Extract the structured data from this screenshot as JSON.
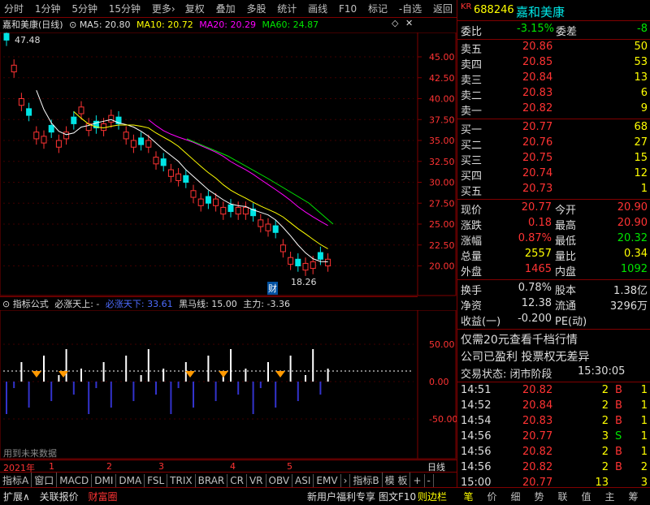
{
  "toolbar": {
    "items": [
      "分时",
      "1分钟",
      "5分钟",
      "15分钟",
      "更多›"
    ],
    "right": [
      "复权",
      "叠加",
      "多股",
      "统计",
      "画线",
      "F10",
      "标记",
      "-自选",
      "返回"
    ]
  },
  "chart": {
    "title": "嘉和美康(日线)",
    "ma5": "MA5: 20.80",
    "ma10": "MA10: 20.72",
    "ma20": "MA20: 20.29",
    "ma60": "MA60: 24.87",
    "high_label": "47.48",
    "low_label": "18.26",
    "cai": "财",
    "y_ticks": [
      "45.00",
      "42.50",
      "40.00",
      "37.50",
      "35.00",
      "32.50",
      "30.00",
      "27.50",
      "25.00",
      "22.50",
      "20.00"
    ]
  },
  "indicator": {
    "name": "指标公式",
    "label1": "必涨天上: -",
    "label2": "必涨天下: 33.61",
    "label3": "黑马线: 15.00",
    "label4": "主力: -3.36",
    "y_ticks": [
      "50.00",
      "0.00",
      "-50.00"
    ],
    "future": "用到未来数据"
  },
  "timeline": {
    "year": "2021年",
    "months": [
      "1",
      "2",
      "3",
      "4",
      "5"
    ],
    "period": "日线"
  },
  "tabs": [
    "指标A",
    "窗口",
    "MACD",
    "DMI",
    "DMA",
    "FSL",
    "TRIX",
    "BRAR",
    "CR",
    "VR",
    "OBV",
    "ASI",
    "EMV",
    "›",
    "指标B",
    "模 板",
    "+",
    "-"
  ],
  "bottom": {
    "left": [
      "扩展∧",
      "关联报价",
      "财富圈"
    ],
    "center": "新用户福利专享",
    "right_labels": [
      "图文F10",
      "则边栏"
    ],
    "right_tabs": [
      "笔",
      "价",
      "细",
      "势",
      "联",
      "值",
      "主",
      "筹"
    ]
  },
  "quote": {
    "market": "KR",
    "code": "688246",
    "name": "嘉和美康",
    "weibi": {
      "label": "委比",
      "value": "-3.15%",
      "label2": "委差",
      "value2": "-8"
    },
    "sells": [
      {
        "l": "卖五",
        "p": "20.86",
        "v": "50"
      },
      {
        "l": "卖四",
        "p": "20.85",
        "v": "53"
      },
      {
        "l": "卖三",
        "p": "20.84",
        "v": "13"
      },
      {
        "l": "卖二",
        "p": "20.83",
        "v": "6"
      },
      {
        "l": "卖一",
        "p": "20.82",
        "v": "9"
      }
    ],
    "buys": [
      {
        "l": "买一",
        "p": "20.77",
        "v": "68"
      },
      {
        "l": "买二",
        "p": "20.76",
        "v": "27"
      },
      {
        "l": "买三",
        "p": "20.75",
        "v": "15"
      },
      {
        "l": "买四",
        "p": "20.74",
        "v": "12"
      },
      {
        "l": "买五",
        "p": "20.73",
        "v": "1"
      }
    ],
    "stats": [
      {
        "l1": "现价",
        "v1": "20.77",
        "l2": "今开",
        "v2": "20.90"
      },
      {
        "l1": "涨跌",
        "v1": "0.18",
        "l2": "最高",
        "v2": "20.90"
      },
      {
        "l1": "涨幅",
        "v1": "0.87%",
        "l2": "最低",
        "v2": "20.32"
      },
      {
        "l1": "总量",
        "v1": "2557",
        "l2": "量比",
        "v2": "0.34"
      },
      {
        "l1": "外盘",
        "v1": "1465",
        "l2": "内盘",
        "v2": "1092"
      }
    ],
    "stats2": [
      {
        "l1": "换手",
        "v1": "0.78%",
        "l2": "股本",
        "v2": "1.38亿"
      },
      {
        "l1": "净资",
        "v1": "12.38",
        "l2": "流通",
        "v2": "3296万"
      },
      {
        "l1": "收益(一)",
        "v1": "-0.200",
        "l2": "PE(动)",
        "v2": ""
      }
    ],
    "ad1": "仅需20元查看千档行情",
    "ad2": "公司已盈利 投票权无差异",
    "status_label": "交易状态: 闭市阶段",
    "status_time": "15:30:05",
    "ticks": [
      {
        "t": "14:51",
        "p": "20.82",
        "v": "2",
        "d": "B",
        "n": "1"
      },
      {
        "t": "14:52",
        "p": "20.84",
        "v": "2",
        "d": "B",
        "n": "1"
      },
      {
        "t": "14:54",
        "p": "20.83",
        "v": "2",
        "d": "B",
        "n": "1"
      },
      {
        "t": "14:56",
        "p": "20.77",
        "v": "3",
        "d": "S",
        "n": "1"
      },
      {
        "t": "14:56",
        "p": "20.82",
        "v": "2",
        "d": "B",
        "n": "1"
      },
      {
        "t": "14:56",
        "p": "20.82",
        "v": "2",
        "d": "B",
        "n": "2"
      },
      {
        "t": "15:00",
        "p": "20.77",
        "v": "13",
        "d": "",
        "n": "3"
      }
    ]
  },
  "chart_data": {
    "type": "line",
    "title": "嘉和美康(日线)",
    "price_range": [
      18.26,
      47.48
    ],
    "series": [
      {
        "name": "MA5",
        "values": [
          20.8
        ]
      },
      {
        "name": "MA10",
        "values": [
          20.72
        ]
      },
      {
        "name": "MA20",
        "values": [
          20.29
        ]
      },
      {
        "name": "MA60",
        "values": [
          24.87
        ]
      }
    ]
  }
}
